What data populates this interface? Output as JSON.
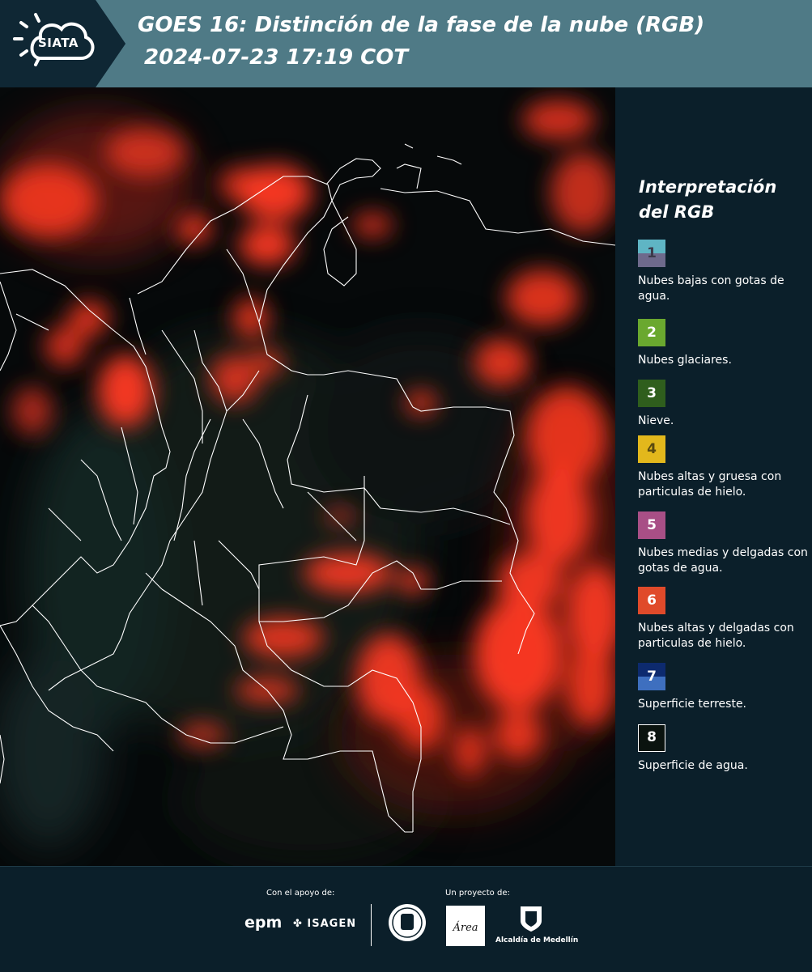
{
  "header": {
    "logo_text": "SIATA",
    "title_line1": "GOES 16: Distinción de la fase de la nube (RGB)",
    "title_line2": "2024-07-23 17:19 COT"
  },
  "legend": {
    "title": "Interpretación del RGB",
    "items": [
      {
        "number": "1",
        "label": "Nubes bajas con gotas de agua.",
        "color_top": "#5fb5c4",
        "color_bottom": "#6e6a8c"
      },
      {
        "number": "2",
        "label": "Nubes glaciares.",
        "color": "#6aa82f"
      },
      {
        "number": "3",
        "label": "Nieve.",
        "color": "#2f5e1d"
      },
      {
        "number": "4",
        "label": "Nubes altas y gruesa con particulas de hielo.",
        "color": "#e3b81c"
      },
      {
        "number": "5",
        "label": "Nubes medias y delgadas con gotas de agua.",
        "color": "#a84f86"
      },
      {
        "number": "6",
        "label": "Nubes altas y delgadas con particulas de hielo.",
        "color": "#e04a2a"
      },
      {
        "number": "7",
        "label": "Superficie terreste.",
        "color_top": "#0d2a6e",
        "color_bottom": "#3e6fbf"
      },
      {
        "number": "8",
        "label": "Superficie de agua.",
        "color": "#0a130f"
      }
    ]
  },
  "footer": {
    "support_label": "Con el apoyo de:",
    "project_label": "Un proyecto de:",
    "epm": "epm",
    "isagen": "ISAGEN",
    "area": "Área",
    "alcaldia": "Alcaldía de Medellín"
  },
  "colors": {
    "header_band": "#4f7a86",
    "cloud": "#ff3a22",
    "background": "#0b1f2a"
  }
}
